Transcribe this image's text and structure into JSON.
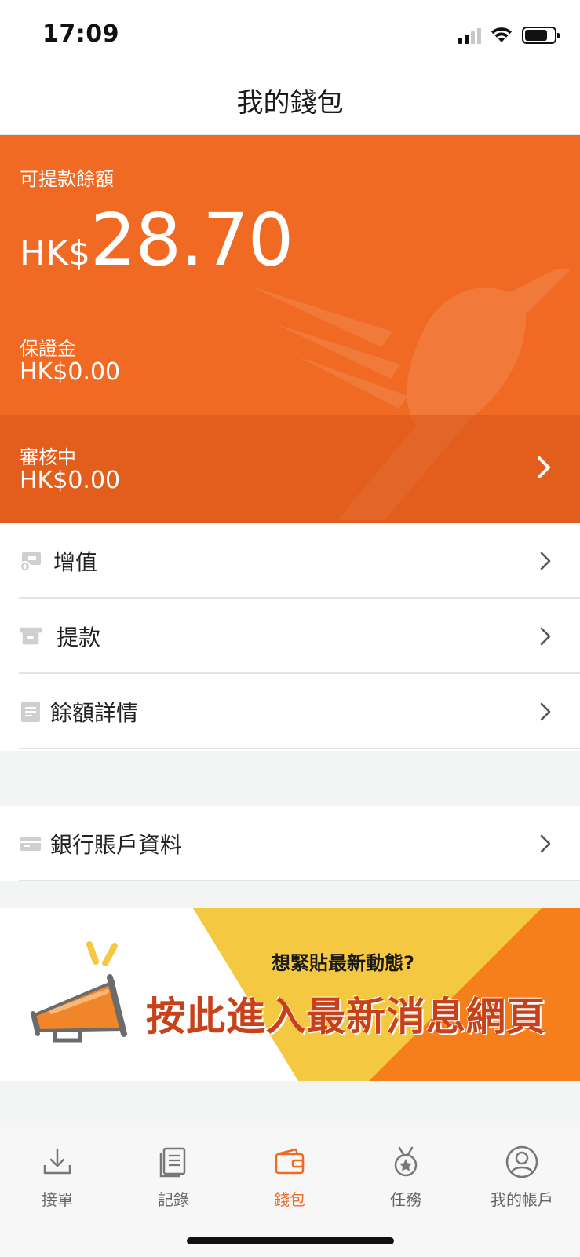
{
  "status_bar": {
    "time": "17:09"
  },
  "nav": {
    "title": "我的錢包"
  },
  "balance": {
    "available_label": "可提款餘額",
    "currency": "HK$",
    "available_amount": "28.70",
    "deposit_label": "保證金",
    "deposit_amount": "HK$0.00",
    "review_label": "審核中",
    "review_amount": "HK$0.00"
  },
  "menu": {
    "items": [
      {
        "label": "增值",
        "icon": "top-up-icon"
      },
      {
        "label": "提款",
        "icon": "withdraw-icon"
      },
      {
        "label": "餘額詳情",
        "icon": "document-icon"
      }
    ],
    "bank": {
      "label": "銀行賬戶資料",
      "icon": "card-icon"
    }
  },
  "banner": {
    "subtitle": "想緊貼最新動態?",
    "title": "按此進入最新消息網頁"
  },
  "tabs": [
    {
      "label": "接單",
      "icon": "download-icon"
    },
    {
      "label": "記錄",
      "icon": "records-icon"
    },
    {
      "label": "錢包",
      "icon": "wallet-icon",
      "active": true
    },
    {
      "label": "任務",
      "icon": "medal-icon"
    },
    {
      "label": "我的帳戶",
      "icon": "profile-icon"
    }
  ],
  "colors": {
    "brand_orange": "#f06a24",
    "banner_yellow": "#f5c842",
    "banner_orange": "#f77f1b",
    "banner_text": "#c8411a"
  }
}
